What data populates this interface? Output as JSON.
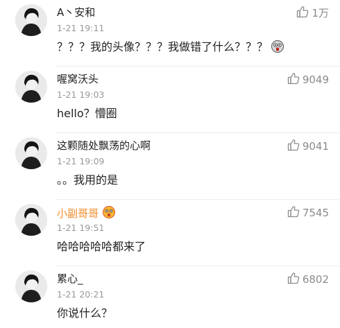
{
  "comments": [
    {
      "username": "A丶安和",
      "time": "1-21 19:11",
      "text": "？？？我的头像？？？我做错了什么？？？",
      "likes": "1万",
      "has_text_emoji": true
    },
    {
      "username": "喔窝沃头",
      "time": "1-21 19:03",
      "text": "hello？懵圈",
      "likes": "9049"
    },
    {
      "username": "这颗随处飘荡的心啊",
      "time": "1-21 19:09",
      "text": "。。我用的是",
      "likes": "9041"
    },
    {
      "username": "小副哥哥",
      "time": "1-21 19:51",
      "text": "哈哈哈哈哈都来了",
      "likes": "7545",
      "vip": true
    },
    {
      "username": "累心_",
      "time": "1-21 20:21",
      "text": "你说什么？",
      "likes": "6802"
    }
  ],
  "colors": {
    "vip_name": "#f28c28",
    "meta": "#999999",
    "text": "#222222"
  },
  "icons": {
    "like": "thumbs-up-icon",
    "avatar": "avatar",
    "emoji": "surprised-face-icon"
  }
}
